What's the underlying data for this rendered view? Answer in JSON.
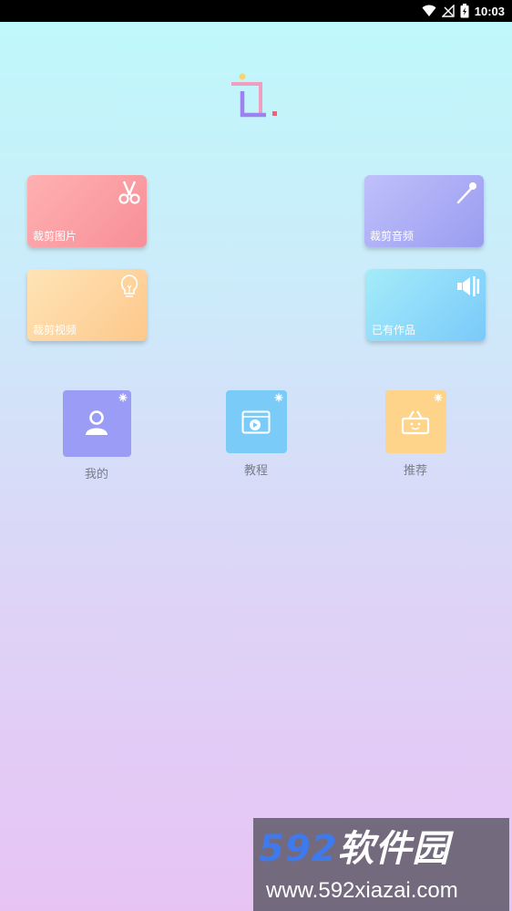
{
  "status_bar": {
    "time": "10:03",
    "icons": [
      "wifi-icon",
      "no-signal-icon",
      "battery-charging-icon"
    ]
  },
  "app": {
    "logo_icon": "crop-icon"
  },
  "cards": {
    "crop_image": {
      "label": "裁剪图片",
      "icon": "scissors-icon"
    },
    "crop_audio": {
      "label": "裁剪音频",
      "icon": "audio-wand-icon"
    },
    "crop_video": {
      "label": "裁剪视频",
      "icon": "lightbulb-icon"
    },
    "my_works": {
      "label": "已有作品",
      "icon": "speaker-icon"
    }
  },
  "nav": {
    "mine": {
      "label": "我的",
      "icon": "user-icon"
    },
    "tutorial": {
      "label": "教程",
      "icon": "video-player-icon"
    },
    "recommend": {
      "label": "推荐",
      "icon": "basket-icon"
    }
  },
  "watermark": {
    "number": "592",
    "brand": "软件园",
    "url": "www.592xiazai.com"
  },
  "colors": {
    "card_image": "#f78f97",
    "card_audio": "#9a9cf1",
    "card_video": "#fdc88b",
    "card_works": "#7ac9fa",
    "nav_mine": "#9b9cf6",
    "nav_tutorial": "#7bcbf8",
    "nav_recommend": "#fdd489",
    "label_text": "#777c89"
  }
}
